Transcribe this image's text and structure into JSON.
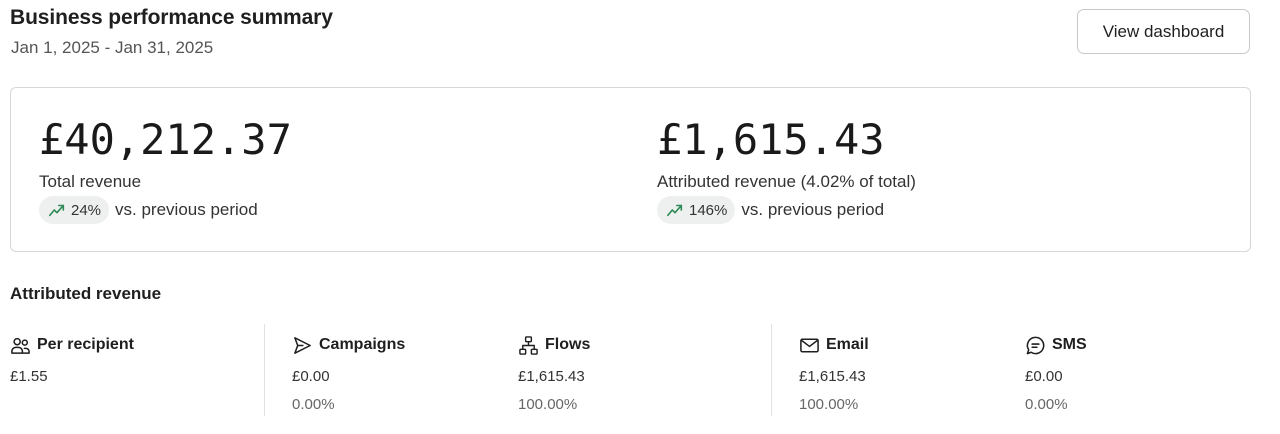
{
  "header": {
    "title": "Business performance summary",
    "date_range": "Jan 1, 2025 - Jan 31, 2025",
    "view_button_label": "View dashboard"
  },
  "summary": {
    "total": {
      "value": "£40,212.37",
      "label": "Total revenue",
      "change": "24%",
      "change_icon": "trend-up-icon",
      "vs_text": "vs. previous period"
    },
    "attributed": {
      "value": "£1,615.43",
      "label": "Attributed revenue (4.02% of total)",
      "change": "146%",
      "change_icon": "trend-up-icon",
      "vs_text": "vs. previous period"
    },
    "trend_color": "#2e8b57"
  },
  "attributed_section": {
    "title": "Attributed revenue",
    "columns": [
      {
        "label": "Per recipient",
        "icon": "people-icon",
        "value": "£1.55",
        "percent": ""
      },
      {
        "label": "Campaigns",
        "icon": "send-icon",
        "value": "£0.00",
        "percent": "0.00%"
      },
      {
        "label": "Flows",
        "icon": "flow-icon",
        "value": "£1,615.43",
        "percent": "100.00%"
      },
      {
        "label": "Email",
        "icon": "mail-icon",
        "value": "£1,615.43",
        "percent": "100.00%"
      },
      {
        "label": "SMS",
        "icon": "chat-icon",
        "value": "£0.00",
        "percent": "0.00%"
      }
    ]
  }
}
